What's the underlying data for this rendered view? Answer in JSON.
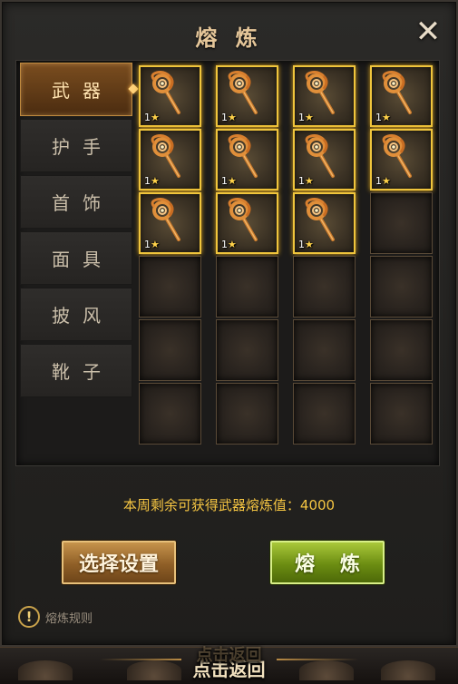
{
  "window": {
    "title": "熔 炼",
    "close_glyph": "✕"
  },
  "tabs": [
    {
      "label": "武器",
      "active": true
    },
    {
      "label": "护手",
      "active": false
    },
    {
      "label": "首饰",
      "active": false
    },
    {
      "label": "面具",
      "active": false
    },
    {
      "label": "披风",
      "active": false
    },
    {
      "label": "靴子",
      "active": false
    }
  ],
  "grid": {
    "columns": 4,
    "rows": 6,
    "filled_slots": [
      {
        "icon": "staff-icon",
        "level": "1"
      },
      {
        "icon": "staff-icon",
        "level": "1"
      },
      {
        "icon": "staff-icon",
        "level": "1"
      },
      {
        "icon": "staff-icon",
        "level": "1"
      },
      {
        "icon": "staff-icon",
        "level": "1"
      },
      {
        "icon": "staff-icon",
        "level": "1"
      },
      {
        "icon": "staff-icon",
        "level": "1"
      },
      {
        "icon": "staff-icon",
        "level": "1"
      },
      {
        "icon": "staff-icon",
        "level": "1"
      },
      {
        "icon": "staff-icon",
        "level": "1"
      },
      {
        "icon": "staff-icon",
        "level": "1"
      }
    ],
    "star_glyph": "★"
  },
  "info": {
    "text": "本周剩余可获得武器熔炼值：4000"
  },
  "buttons": {
    "settings_label": "选择设置",
    "smelt_label": "熔 炼"
  },
  "rules": {
    "icon_glyph": "!",
    "label": "熔炼规则"
  },
  "footer": {
    "back_label": "点击返回"
  },
  "colors": {
    "title": "#e6c79a",
    "info_text": "#f5c542",
    "slot_border_filled": "#f0c53c",
    "settings_button": "#a8763a",
    "smelt_button": "#8fb02a"
  }
}
